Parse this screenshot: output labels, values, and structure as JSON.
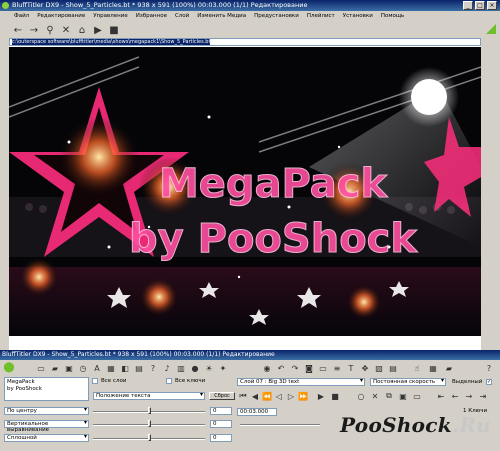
{
  "window1": {
    "title": "BluffTitler DX9 - Show_5_Particles.bt * 938 x 591 (100%) 00:03.000 (1/1) Редактирование",
    "menu": [
      "Файл",
      "Редактирование",
      "Управление",
      "Избранное",
      "Слой",
      "Изменить Медиа",
      "Предустановки",
      "Плейлист",
      "Установки",
      "Помощь"
    ],
    "address": "c:\\outerspace software\\blufftitler\\media\\shows\\megapack1\\Show_5_Particles.bt",
    "preview_text": {
      "line1": "MegaPack",
      "line2": "by PooShock"
    }
  },
  "window2": {
    "title": "BluffTitler DX9 - Show_5_Particles.bt * 938 x 591 (100%) 00:03.000 (1/1) Редактирование",
    "text_content": "MegaPack\nby PooShock",
    "all_layers_label": "Все слои",
    "all_keys_label": "Все ключи",
    "layer_select": "Слой    07 : Big 3D text",
    "speed_select": "Постоянная скорость",
    "selected_label": "Выделный",
    "text_position_select": "Положение текста",
    "reset_button": "Сброс",
    "align_select": "По центру",
    "vertical_align_select": "Вертикальное выравнивание",
    "fade_select": "Сплошной",
    "num1": "0",
    "num2": "0",
    "num3": "0",
    "time_value": "00:03.000",
    "keys_label": "1 Ключи",
    "selected_checked": "✓"
  },
  "watermark": {
    "text_main": "PooShock",
    "text_suffix": ".Ru"
  },
  "colors": {
    "accent": "#ff2e7e",
    "titlebar": "#0a246a",
    "panel_bg": "#d4d0c8"
  }
}
